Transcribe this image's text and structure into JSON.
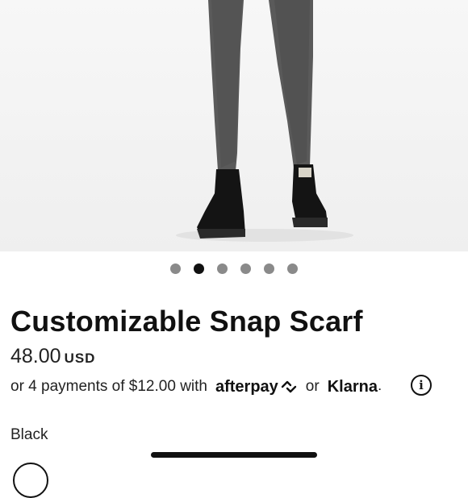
{
  "product": {
    "title": "Customizable Snap Scarf",
    "price_amount": "48.00",
    "price_currency": "USD"
  },
  "payments": {
    "prefix": "or 4 payments of $12.00 with",
    "afterpay_label": "afterpay",
    "or_label": "or",
    "klarna_label": "Klarna",
    "klarna_mark": "."
  },
  "carousel": {
    "count": 6,
    "active_index": 1
  },
  "color": {
    "selected_label": "Black"
  },
  "colors": {
    "active_dot": "#111111",
    "inactive_dot": "#8a8a8a",
    "text": "#1a1a1a"
  }
}
